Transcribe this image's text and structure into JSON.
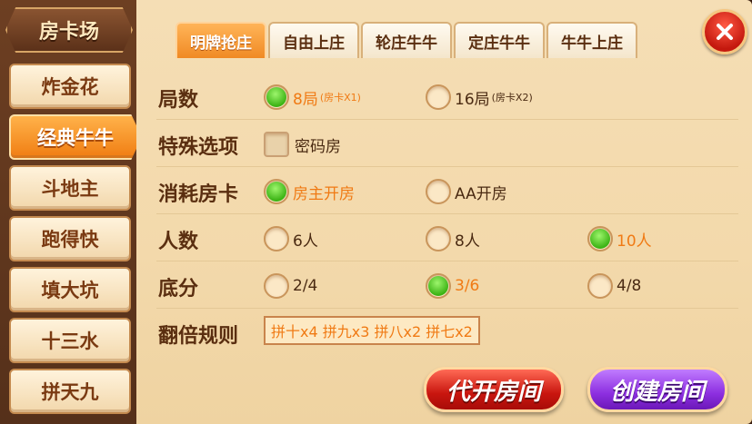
{
  "sidebar": {
    "title": "房卡场",
    "games": [
      "炸金花",
      "经典牛牛",
      "斗地主",
      "跑得快",
      "填大坑",
      "十三水",
      "拼天九"
    ],
    "active_index": 1
  },
  "tabs": [
    {
      "label": "明牌抢庄",
      "active": true
    },
    {
      "label": "自由上庄",
      "active": false
    },
    {
      "label": "轮庄牛牛",
      "active": false
    },
    {
      "label": "定庄牛牛",
      "active": false
    },
    {
      "label": "牛牛上庄",
      "active": false
    }
  ],
  "close_icon": "close-icon",
  "rounds": {
    "label": "局数",
    "options": [
      {
        "label": "8局",
        "sub": "(房卡X1)",
        "selected": true
      },
      {
        "label": "16局",
        "sub": "(房卡X2)",
        "selected": false
      }
    ]
  },
  "special": {
    "label": "特殊选项",
    "options": [
      {
        "label": "密码房",
        "checked": false
      }
    ]
  },
  "card_cost": {
    "label": "消耗房卡",
    "options": [
      {
        "label": "房主开房",
        "selected": true
      },
      {
        "label": "AA开房",
        "selected": false
      }
    ]
  },
  "players": {
    "label": "人数",
    "options": [
      {
        "label": "6人",
        "selected": false
      },
      {
        "label": "8人",
        "selected": false
      },
      {
        "label": "10人",
        "selected": true
      }
    ]
  },
  "base_score": {
    "label": "底分",
    "options": [
      {
        "label": "2/4",
        "selected": false
      },
      {
        "label": "3/6",
        "selected": true
      },
      {
        "label": "4/8",
        "selected": false
      }
    ]
  },
  "multiplier": {
    "label": "翻倍规则",
    "value": "拼十x4 拼九x3 拼八x2 拼七x2"
  },
  "actions": {
    "proxy": "代开房间",
    "create": "创建房间"
  },
  "colors": {
    "selected_text": "#f07a14",
    "radio_selected": "#3cb315"
  }
}
